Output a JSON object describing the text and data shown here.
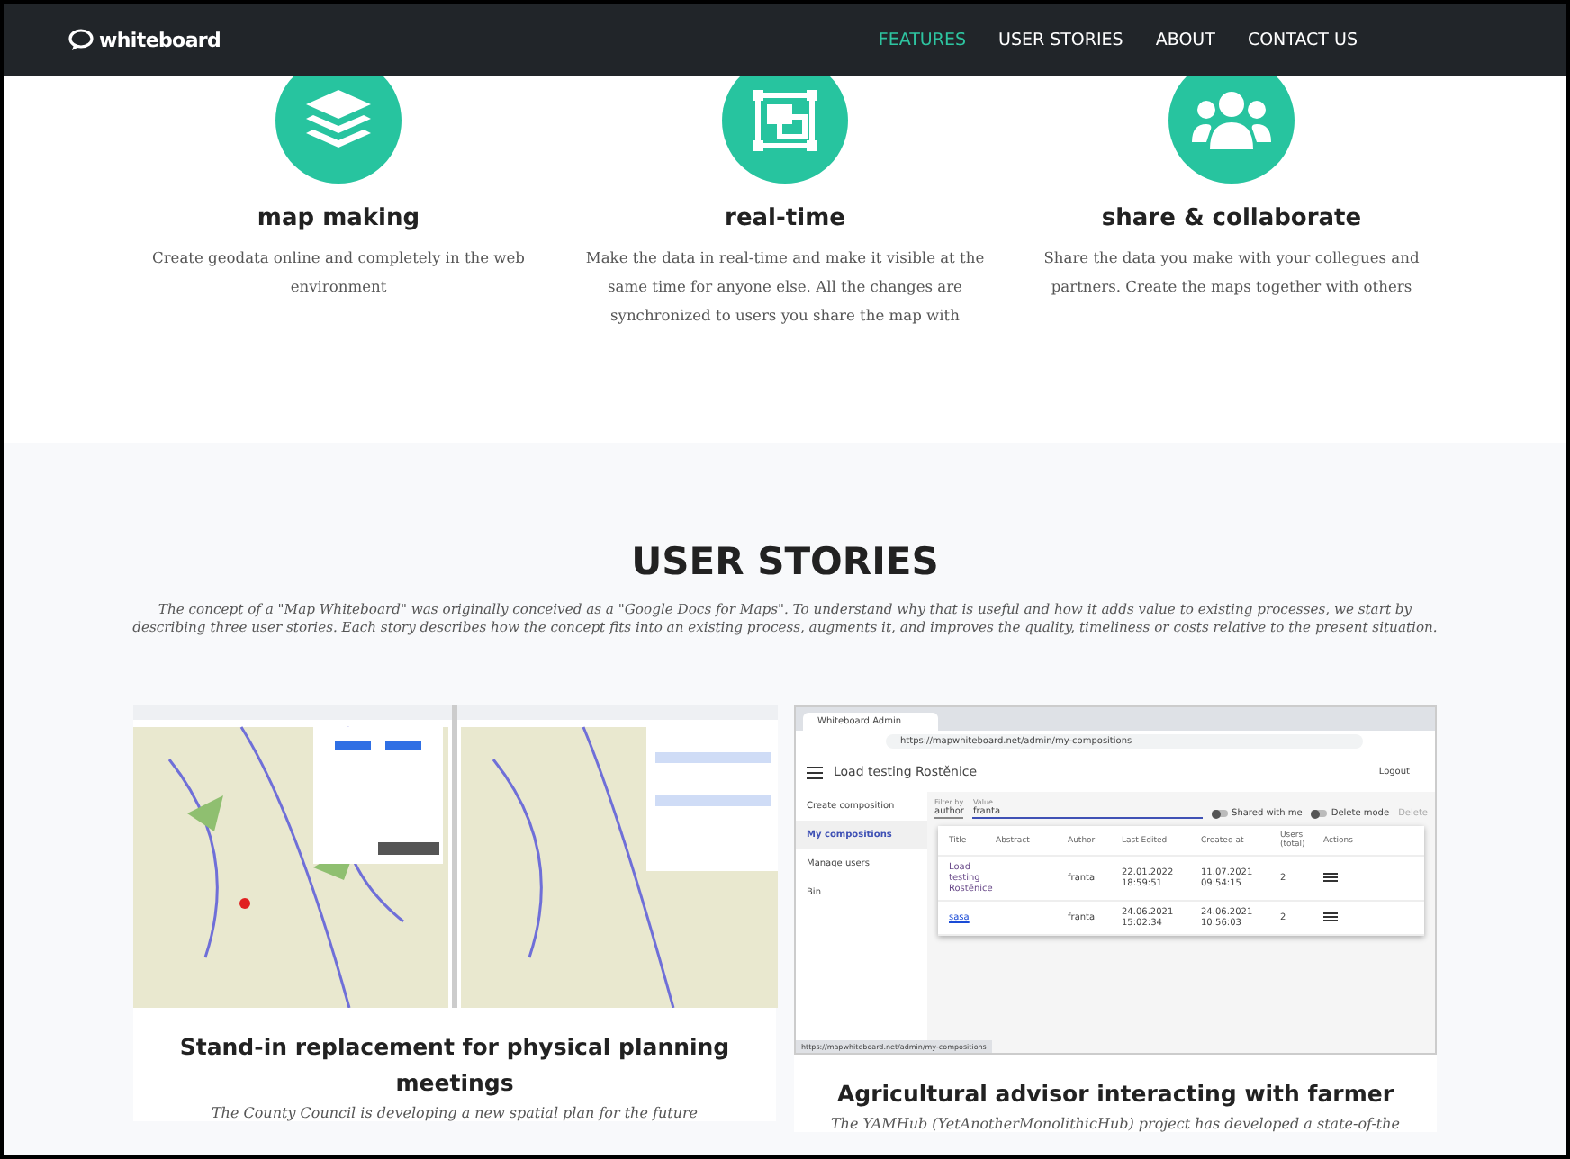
{
  "nav": {
    "logo": "whiteboard",
    "links": [
      {
        "label": "FEATURES",
        "selected": true
      },
      {
        "label": "USER STORIES",
        "selected": false
      },
      {
        "label": "ABOUT",
        "selected": false
      },
      {
        "label": "CONTACT US",
        "selected": false
      }
    ]
  },
  "features": [
    {
      "kind": "layers",
      "title": "map making",
      "text": "Create geodata online and completely in the web environment"
    },
    {
      "kind": "realtime",
      "title": "real-time",
      "text": "Make the data in real-time and make it visible at the same time for anyone else. All the changes are synchronized to users you share the map with"
    },
    {
      "kind": "people",
      "title": "share & collaborate",
      "text": "Share the data you make with your collegues and partners. Create the maps together with others"
    }
  ],
  "stories": {
    "title": "USER STORIES",
    "intro": "The concept of a \"Map Whiteboard\" was originally conceived as a \"Google Docs for Maps\". To understand why that is useful and how it adds value to existing processes, we start by describing three user stories. Each story describes how the concept fits into an existing process, augments it, and improves the quality, timeliness or costs relative to the present situation.",
    "cards": [
      {
        "kind": "maps",
        "title": "Stand-in replacement for physical planning meetings",
        "text": "The County Council is developing a new spatial plan for the future"
      },
      {
        "kind": "admin",
        "title": "Agricultural advisor interacting with farmer",
        "text": "The YAMHub (YetAnotherMonolithicHub) project has developed a state-of-the",
        "screenshot": {
          "tab": "Whiteboard Admin",
          "url": "https://mapwhiteboard.net/admin/my-compositions",
          "app_title": "Load testing Rostěnice",
          "logout": "Logout",
          "menu": [
            {
              "label": "Create composition",
              "selected": false
            },
            {
              "label": "My compositions",
              "selected": true
            },
            {
              "label": "Manage users",
              "selected": false
            },
            {
              "label": "Bin",
              "selected": false
            }
          ],
          "filter_label": "Filter by",
          "filter_value": "author",
          "value_label": "Value",
          "value": "franta",
          "toggles": [
            {
              "label": "Shared with me",
              "on": false
            },
            {
              "label": "Delete mode",
              "on": false
            }
          ],
          "delete": "Delete",
          "columns": [
            "Title",
            "Abstract",
            "Author",
            "Last Edited",
            "Created at",
            "Users (total)",
            "Actions"
          ],
          "rows": [
            {
              "title": "Load testing Rostěnice",
              "author": "franta",
              "edited": "22.01.2022 18:59:51",
              "created": "11.07.2021 09:54:15",
              "users": "2"
            },
            {
              "title": "sasa",
              "author": "franta",
              "edited": "24.06.2021 15:02:34",
              "created": "24.06.2021 10:56:03",
              "users": "2"
            }
          ],
          "status": "https://mapwhiteboard.net/admin/my-compositions"
        }
      }
    ]
  }
}
